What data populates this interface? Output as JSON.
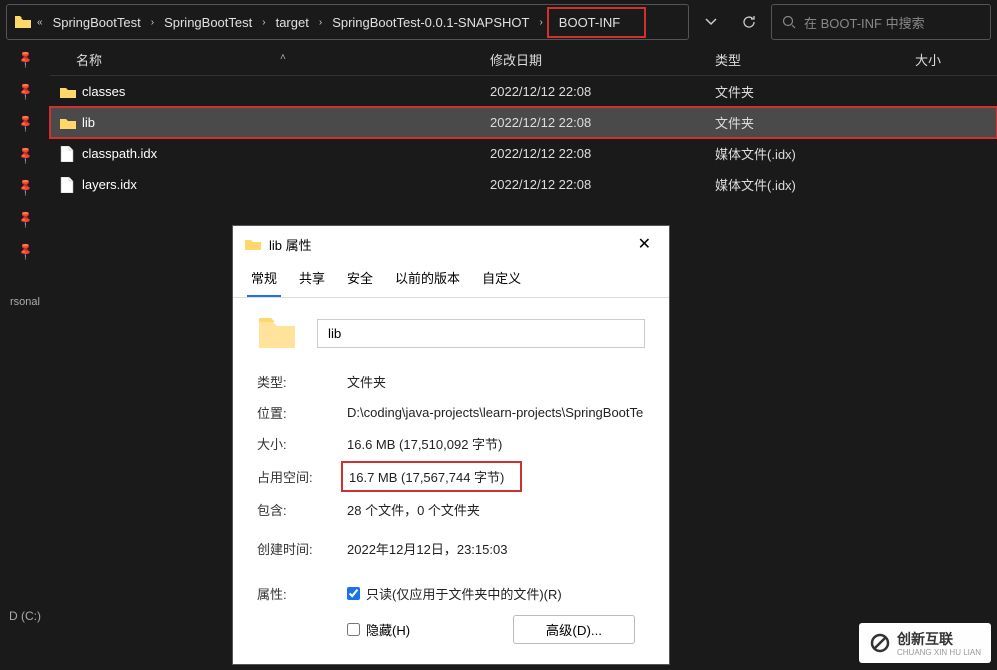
{
  "breadcrumb": {
    "ellipsis": "«",
    "items": [
      "SpringBootTest",
      "SpringBootTest",
      "target",
      "SpringBootTest-0.0.1-SNAPSHOT",
      "BOOT-INF"
    ]
  },
  "search": {
    "placeholder": "在 BOOT-INF 中搜索"
  },
  "columns": {
    "name": "名称",
    "modified": "修改日期",
    "type": "类型",
    "size": "大小"
  },
  "rows": [
    {
      "icon": "folder",
      "name": "classes",
      "date": "2022/12/12 22:08",
      "type": "文件夹",
      "selected": false,
      "highlight": false
    },
    {
      "icon": "folder",
      "name": "lib",
      "date": "2022/12/12 22:08",
      "type": "文件夹",
      "selected": true,
      "highlight": true
    },
    {
      "icon": "file",
      "name": "classpath.idx",
      "date": "2022/12/12 22:08",
      "type": "媒体文件(.idx)",
      "selected": false,
      "highlight": false
    },
    {
      "icon": "file",
      "name": "layers.idx",
      "date": "2022/12/12 22:08",
      "type": "媒体文件(.idx)",
      "selected": false,
      "highlight": false
    }
  ],
  "sidebar": {
    "personal": "rsonal",
    "drive": "D (C:)"
  },
  "dialog": {
    "title": "lib 属性",
    "tabs": [
      "常规",
      "共享",
      "安全",
      "以前的版本",
      "自定义"
    ],
    "name_value": "lib",
    "fields": {
      "type_label": "类型:",
      "type_value": "文件夹",
      "loc_label": "位置:",
      "loc_value": "D:\\coding\\java-projects\\learn-projects\\SpringBootTe",
      "size_label": "大小:",
      "size_value": "16.6 MB (17,510,092 字节)",
      "disk_label": "占用空间:",
      "disk_value": "16.7 MB (17,567,744 字节)",
      "contains_label": "包含:",
      "contains_value": "28 个文件，0 个文件夹",
      "created_label": "创建时间:",
      "created_value": "2022年12月12日，23:15:03",
      "attr_label": "属性:"
    },
    "readonly_label": "只读(仅应用于文件夹中的文件)(R)",
    "hidden_label": "隐藏(H)",
    "advanced_label": "高级(D)..."
  },
  "watermark": {
    "main": "创新互联",
    "sub": "CHUANG XIN HU LIAN"
  }
}
